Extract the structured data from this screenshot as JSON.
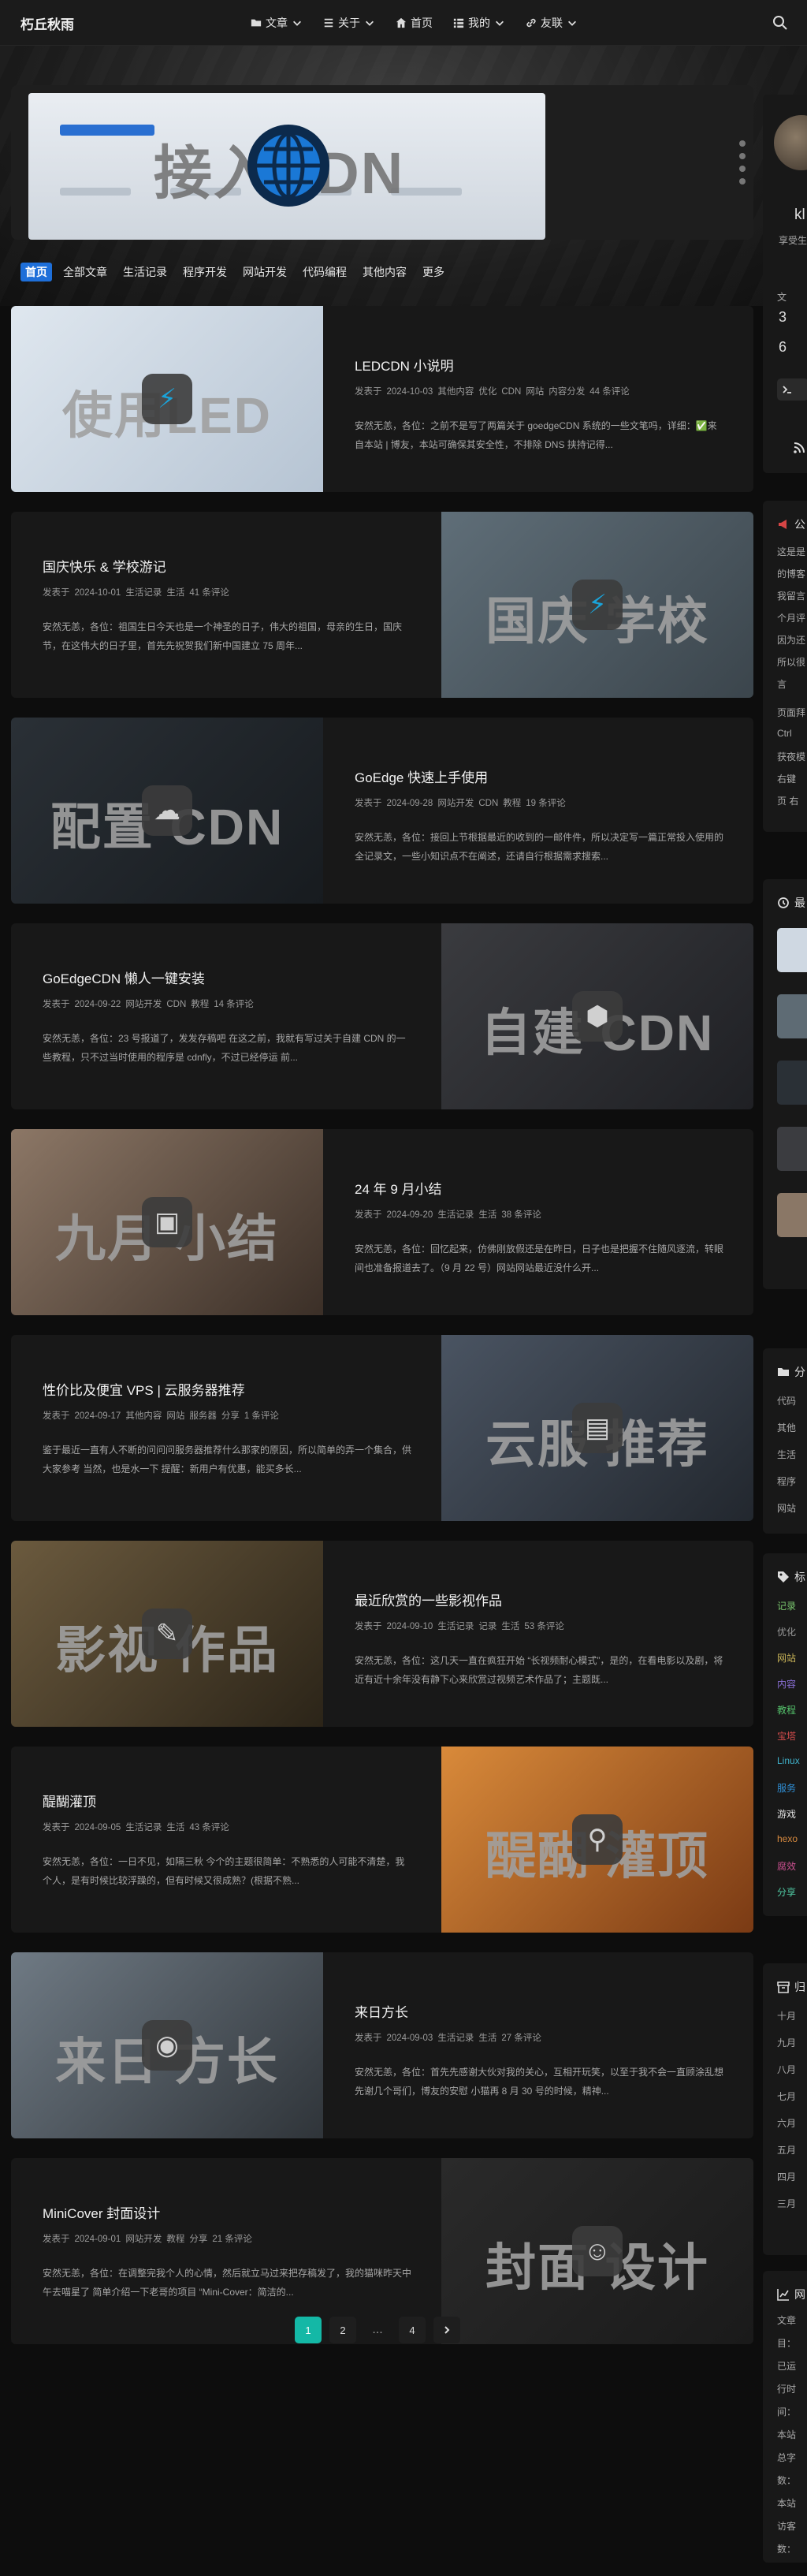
{
  "nav": {
    "brand": "朽丘秋雨",
    "items": [
      {
        "label": "文章",
        "icon": "folder-icon",
        "has_dropdown": true
      },
      {
        "label": "关于",
        "icon": "list-icon",
        "has_dropdown": true
      },
      {
        "label": "首页",
        "icon": "home-icon",
        "has_dropdown": false
      },
      {
        "label": "我的",
        "icon": "grid-icon",
        "has_dropdown": true
      },
      {
        "label": "友联",
        "icon": "link-icon",
        "has_dropdown": true
      }
    ]
  },
  "featured": {
    "title": "接入CDN"
  },
  "categories": [
    "首页",
    "全部文章",
    "生活记录",
    "程序开发",
    "网站开发",
    "代码编程",
    "其他内容",
    "更多"
  ],
  "posts": [
    {
      "title": "LEDCDN 小说明",
      "thumb_label": "使用LED",
      "meta": [
        "发表于",
        "2024-10-03",
        "其他内容",
        "优化",
        "CDN",
        "网站",
        "内容分发",
        "44 条评论"
      ],
      "excerpt": "安然无恙，各位：之前不是写了两篇关于 goedgeCDN 系统的一些文笔吗，详细：✅来自本站 | 博友，本站可确保其安全性，不排除 DNS 挟持记得..."
    },
    {
      "title": "国庆快乐 & 学校游记",
      "thumb_label": "国庆 学校",
      "meta": [
        "发表于",
        "2024-10-01",
        "生活记录",
        "生活",
        "41 条评论"
      ],
      "excerpt": "安然无恙，各位：祖国生日今天也是一个神圣的日子，伟大的祖国，母亲的生日，国庆节，在这伟大的日子里，首先先祝贺我们新中国建立 75 周年..."
    },
    {
      "title": "GoEdge 快速上手使用",
      "thumb_label": "配置 CDN",
      "meta": [
        "发表于",
        "2024-09-28",
        "网站开发",
        "CDN",
        "教程",
        "19 条评论"
      ],
      "excerpt": "安然无恙，各位：接回上节根据最近的收到的一邮件件，所以决定写一篇正常投入使用的全记录文，一些小知识点不在阐述，还请自行根据需求搜索..."
    },
    {
      "title": "GoEdgeCDN 懒人一键安装",
      "thumb_label": "自建 CDN",
      "meta": [
        "发表于",
        "2024-09-22",
        "网站开发",
        "CDN",
        "教程",
        "14 条评论"
      ],
      "excerpt": "安然无恙，各位：23 号报道了，发发存稿吧 在这之前，我就有写过关于自建 CDN 的一些教程，只不过当时使用的程序是 cdnfly，不过已经停运 前..."
    },
    {
      "title": "24 年 9 月小结",
      "thumb_label": "九月 小结",
      "meta": [
        "发表于",
        "2024-09-20",
        "生活记录",
        "生活",
        "38 条评论"
      ],
      "excerpt": "安然无恙，各位：回忆起来，仿佛刚放假还是在昨日，日子也是把握不住随风逐流，转眼间也准备报道去了。（9 月 22 号）网站网站最近没什么开..."
    },
    {
      "title": "性价比及便宜 VPS | 云服务器推荐",
      "thumb_label": "云服 推荐",
      "meta": [
        "发表于",
        "2024-09-17",
        "其他内容",
        "网站",
        "服务器",
        "分享",
        "1 条评论"
      ],
      "excerpt": "鉴于最近一直有人不断的问问问服务器推荐什么那家的原因，所以简单的弄一个集合，供大家参考 当然，也是水一下 提醒：新用户有优惠，能买多长..."
    },
    {
      "title": "最近欣赏的一些影视作品",
      "thumb_label": "影视 作品",
      "meta": [
        "发表于",
        "2024-09-10",
        "生活记录",
        "记录",
        "生活",
        "53 条评论"
      ],
      "excerpt": "安然无恙，各位：这几天一直在疯狂开始 “长视频耐心模式”，是的，在看电影以及剧，将近有近十余年没有静下心来欣赏过视频艺术作品了；主题既..."
    },
    {
      "title": "醍醐灌顶",
      "thumb_label": "醍醐 灌顶",
      "meta": [
        "发表于",
        "2024-09-05",
        "生活记录",
        "生活",
        "43 条评论"
      ],
      "excerpt": "安然无恙，各位：一日不见，如隔三秋 今个的主题很简单：不熟悉的人可能不清楚，我个人，是有时候比较浮躁的，但有时候又很成熟？(根据不熟..."
    },
    {
      "title": "来日方长",
      "thumb_label": "来日 方长",
      "meta": [
        "发表于",
        "2024-09-03",
        "生活记录",
        "生活",
        "27 条评论"
      ],
      "excerpt": "安然无恙，各位：首先先感谢大伙对我的关心，互相开玩笑，以至于我不会一直顾涂乱想 先谢几个哥们，博友的安慰 小猫再 8 月 30 号的时候，精神..."
    },
    {
      "title": "MiniCover 封面设计",
      "thumb_label": "封面 设计",
      "meta": [
        "发表于",
        "2024-09-01",
        "网站开发",
        "教程",
        "分享",
        "21 条评论"
      ],
      "excerpt": "安然无恙，各位：在调整完我个人的心情，然后就立马过来把存稿发了，我的猫咪昨天中午去喵星了 简单介绍一下老哥的项目 “Mini-Cover：简洁的..."
    }
  ],
  "pagination": {
    "pages": [
      "1",
      "2",
      "...",
      "4"
    ],
    "current": "1",
    "next_icon": "chevron-right-icon"
  },
  "sidebar": {
    "profile_name": "kl",
    "profile_tagline": "享受生",
    "stats_labels": [
      "文",
      "3",
      "6"
    ],
    "notice_title": "公",
    "notice_lines": [
      "这是是",
      "的博客",
      "我留言",
      "个月评",
      "因为还",
      "所以很",
      "言"
    ],
    "notice_hints": [
      "页面拜",
      "Ctrl",
      "获夜模",
      "右键",
      "页 右"
    ],
    "recent_title": "最",
    "category_title": "分",
    "category_items": [
      "代码",
      "其他",
      "生活",
      "程序",
      "网站"
    ],
    "tag_title": "标",
    "tag_items": [
      {
        "label": "记录",
        "color": "#7bc96f"
      },
      {
        "label": "优化",
        "color": "#9a9a9a"
      },
      {
        "label": "网站",
        "color": "#c9b458"
      },
      {
        "label": "内容",
        "color": "#8a6fd6"
      },
      {
        "label": "教程",
        "color": "#54c26b"
      },
      {
        "label": "宝塔",
        "color": "#d14b4b"
      },
      {
        "label": "Linux",
        "color": "#3fb0c9"
      },
      {
        "label": "服务",
        "color": "#2f8fd6"
      },
      {
        "label": "游戏",
        "color": "#e0e0e0"
      },
      {
        "label": "hexo",
        "color": "#d6893f"
      },
      {
        "label": "腐效",
        "color": "#c94f8f"
      },
      {
        "label": "分享",
        "color": "#4fc9a3"
      }
    ],
    "archive_title": "归",
    "archive_items": [
      "十月",
      "九月",
      "八月",
      "七月",
      "六月",
      "五月",
      "四月",
      "三月"
    ],
    "site_title": "网",
    "site_items": [
      "文章",
      "目：",
      "已运",
      "行时",
      "间：",
      "本站",
      "总字",
      "数：",
      "本站",
      "访客",
      "数："
    ]
  }
}
